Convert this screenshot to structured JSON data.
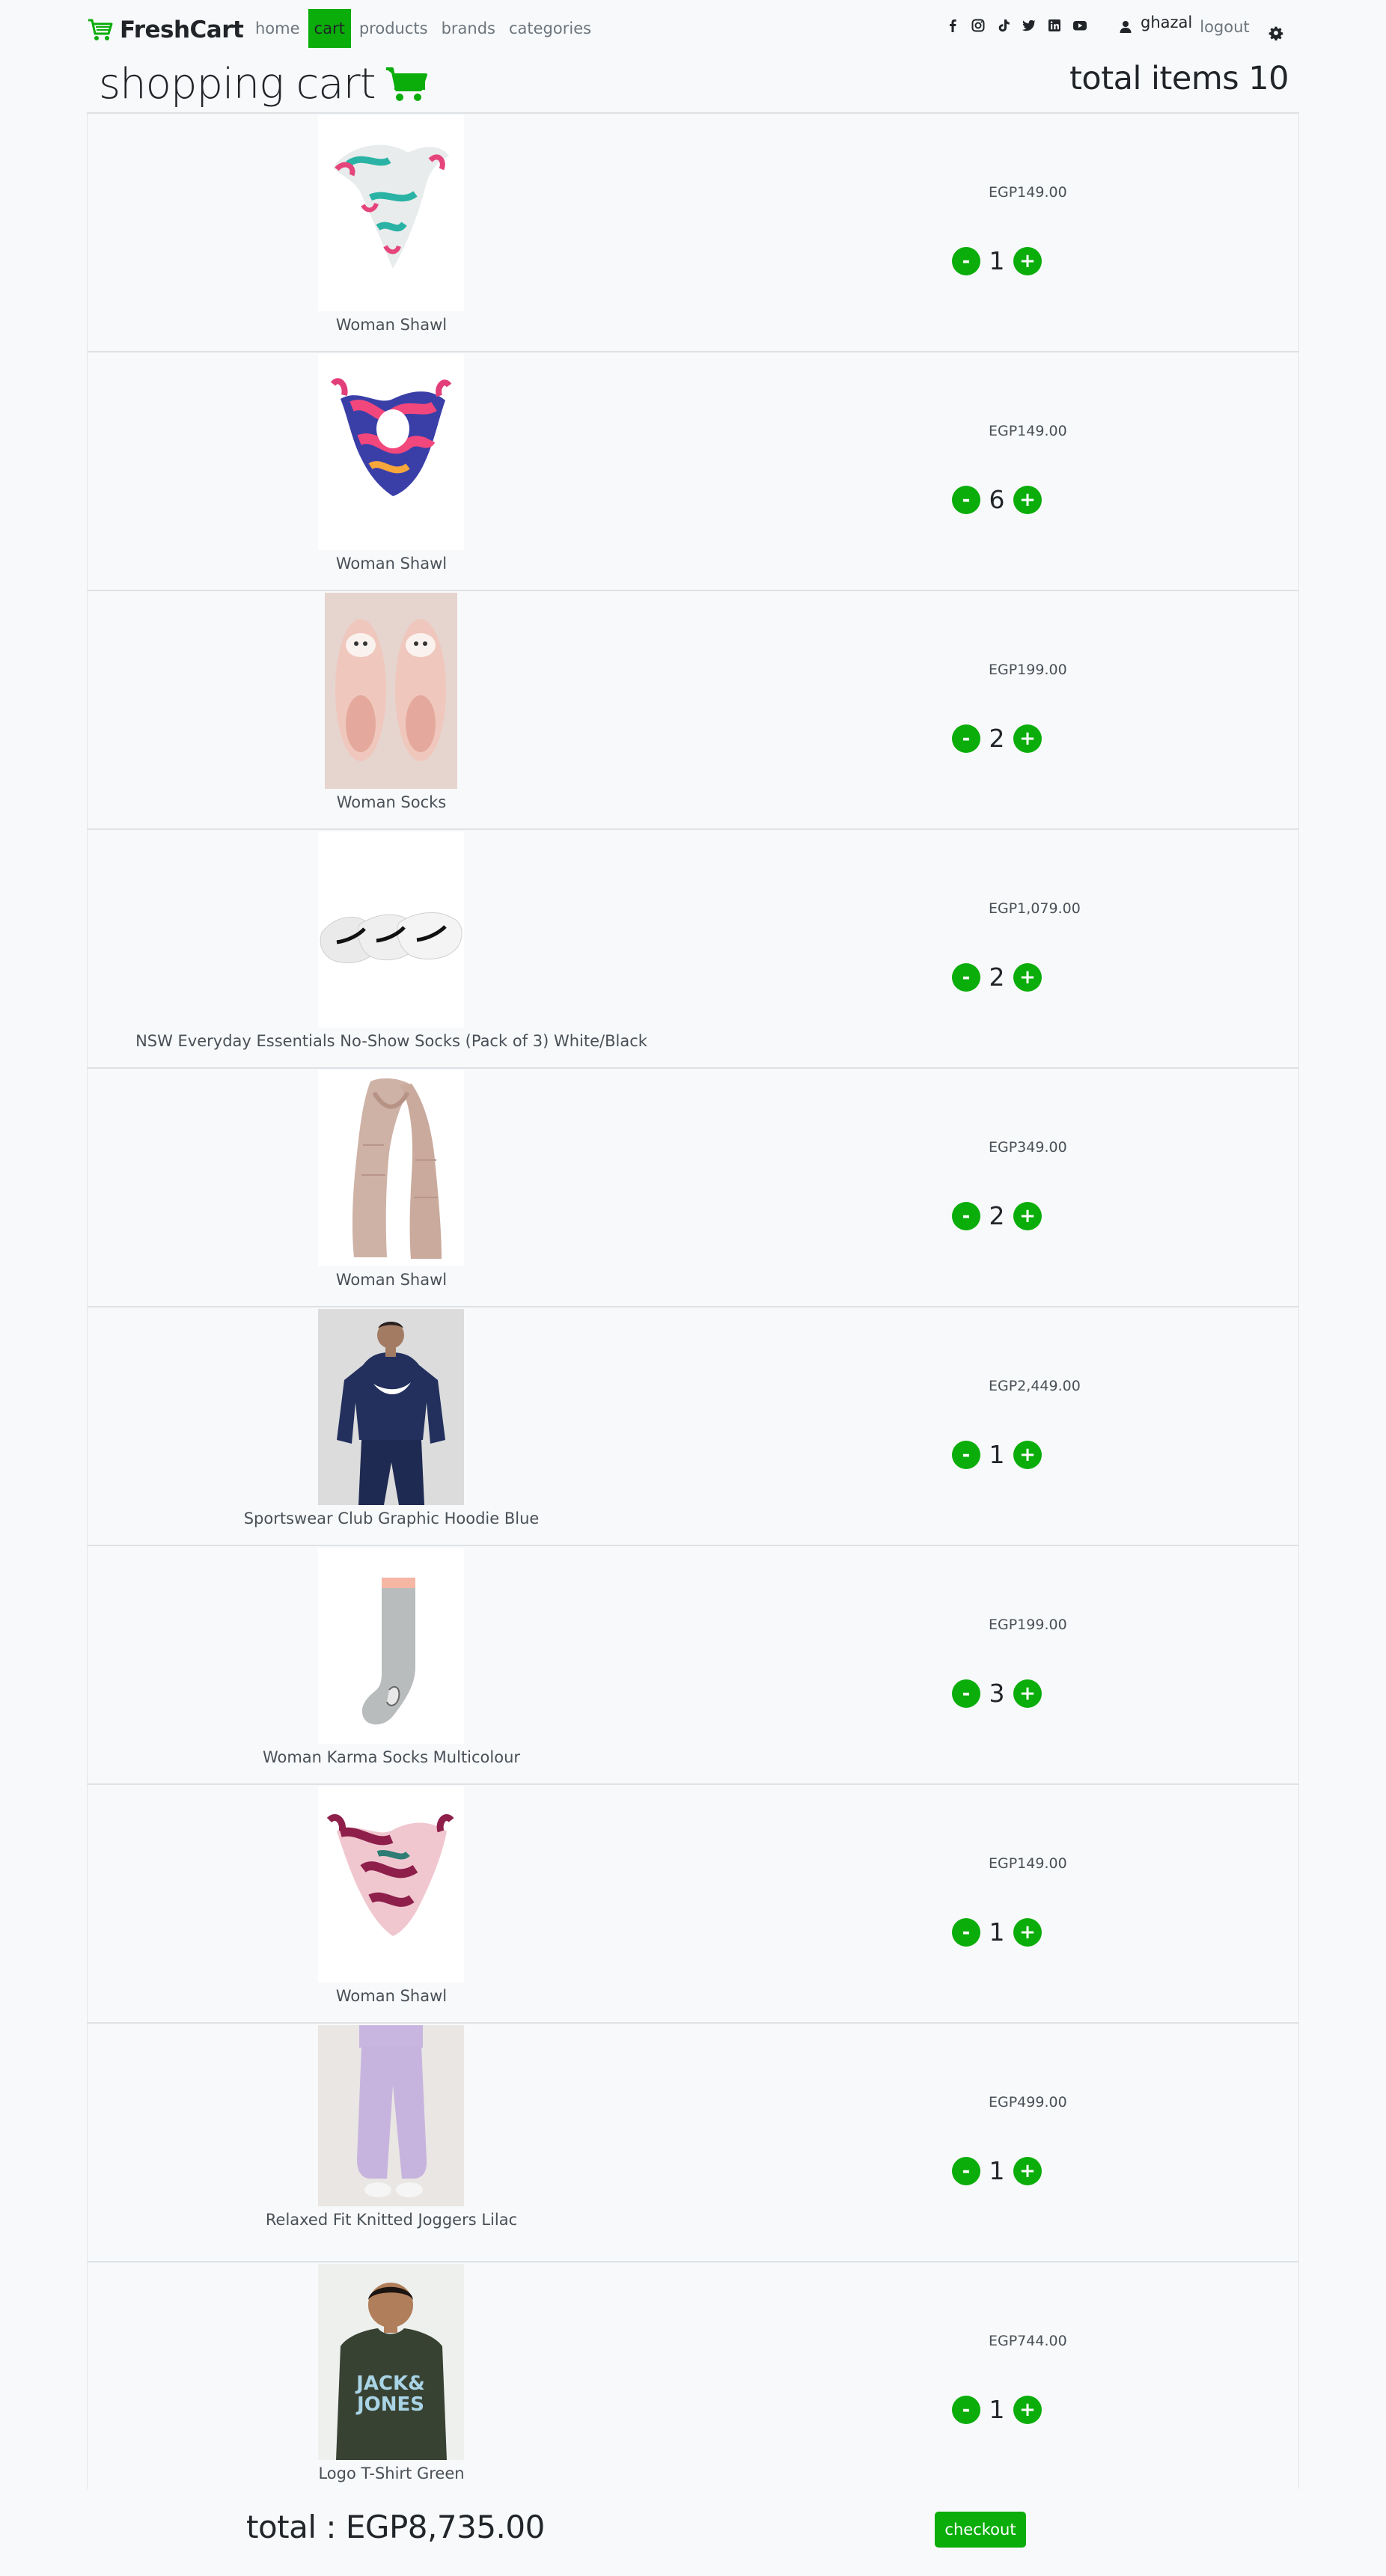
{
  "navbar": {
    "brand": "FreshCart",
    "links": [
      "home",
      "cart",
      "products",
      "brands",
      "categories"
    ],
    "active_link": "cart",
    "social_icons": [
      "facebook-icon",
      "instagram-icon",
      "tiktok-icon",
      "twitter-icon",
      "linkedin-icon",
      "youtube-icon"
    ],
    "user_name": "ghazal",
    "logout_label": "logout"
  },
  "cart": {
    "title": "shopping cart",
    "total_items_label": "total items 10",
    "items": [
      {
        "name": "Woman Shawl",
        "price": "EGP149.00",
        "quantity": "1",
        "image": "shawl-teal"
      },
      {
        "name": "Woman Shawl",
        "price": "EGP149.00",
        "quantity": "6",
        "image": "shawl-pink-blue"
      },
      {
        "name": "Woman Socks",
        "price": "EGP199.00",
        "quantity": "2",
        "image": "socks-fluffy"
      },
      {
        "name": "NSW Everyday Essentials No-Show Socks (Pack of 3) White/Black",
        "price": "EGP1,079.00",
        "quantity": "2",
        "image": "socks-nike"
      },
      {
        "name": "Woman Shawl",
        "price": "EGP349.00",
        "quantity": "2",
        "image": "scarf-beige"
      },
      {
        "name": "Sportswear Club Graphic Hoodie Blue",
        "price": "EGP2,449.00",
        "quantity": "1",
        "image": "hoodie-navy"
      },
      {
        "name": "Woman Karma Socks Multicolour",
        "price": "EGP199.00",
        "quantity": "3",
        "image": "sock-grey"
      },
      {
        "name": "Woman Shawl",
        "price": "EGP149.00",
        "quantity": "1",
        "image": "shawl-burgundy"
      },
      {
        "name": "Relaxed Fit Knitted Joggers Lilac",
        "price": "EGP499.00",
        "quantity": "1",
        "image": "joggers-lilac"
      },
      {
        "name": "Logo T-Shirt Green",
        "price": "EGP744.00",
        "quantity": "1",
        "image": "tshirt-green"
      }
    ],
    "minus_label": "-",
    "plus_label": "+"
  },
  "footer": {
    "total_label": "total : EGP8,735.00",
    "checkout_label": "checkout"
  },
  "colors": {
    "accent": "#0aad0a",
    "background": "#f8f9fa",
    "border": "#dee2e6"
  }
}
